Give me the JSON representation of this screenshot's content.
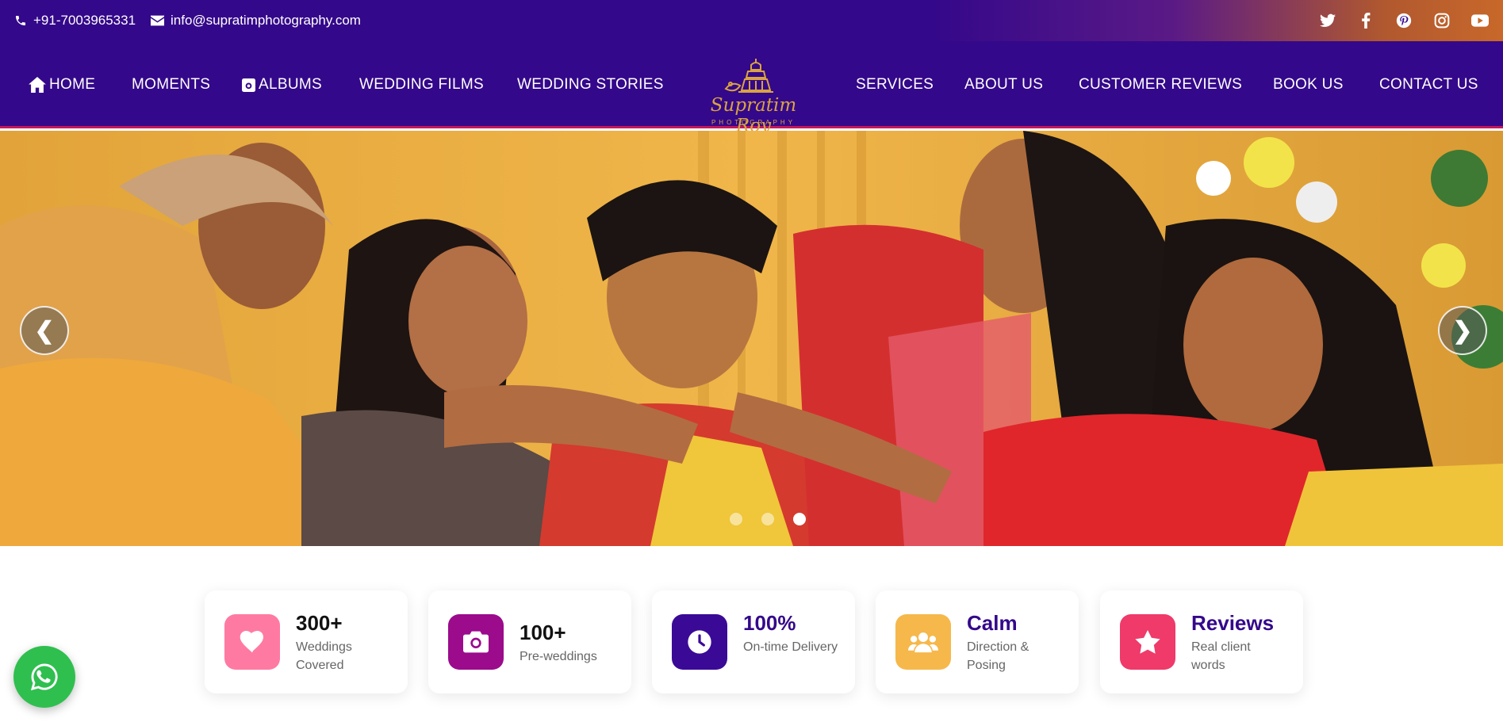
{
  "topbar": {
    "phone": "+91-7003965331",
    "email": "info@supratimphotography.com",
    "social_icons": [
      "twitter-icon",
      "facebook-icon",
      "pinterest-icon",
      "instagram-icon",
      "youtube-icon"
    ]
  },
  "nav": {
    "left": [
      "HOME",
      "MOMENTS",
      "ALBUMS",
      "WEDDING FILMS",
      "WEDDING STORIES"
    ],
    "right": [
      "SERVICES",
      "ABOUT US",
      "CUSTOMER REVIEWS",
      "BOOK US",
      "CONTACT US"
    ]
  },
  "logo": {
    "title": "Supratim Roy",
    "subtitle": "PHOTOGRAPHY"
  },
  "hero": {
    "prev": "❮",
    "next": "❯",
    "slide_count": 3,
    "active_slide": 3
  },
  "stats": [
    {
      "big": "300+",
      "small": "Weddings Covered",
      "icon": "heart-icon",
      "color": "#ff7aa2"
    },
    {
      "big": "100+",
      "small": "Pre-weddings",
      "icon": "camera-icon",
      "color": "#9b0b8c"
    },
    {
      "big": "100%",
      "small": "On-time Delivery",
      "icon": "clock-icon",
      "color": "#3a0a97"
    },
    {
      "big": "Calm",
      "small": "Direction & Posing",
      "icon": "users-icon",
      "color": "#f6b84b"
    },
    {
      "big": "Reviews",
      "small": "Real client words",
      "icon": "star-icon",
      "color": "#ef3a6a"
    }
  ],
  "colors": {
    "primary": "#34088a",
    "accent": "#c2185b",
    "gold": "#d9a441",
    "whatsapp": "#2fbf4f"
  }
}
